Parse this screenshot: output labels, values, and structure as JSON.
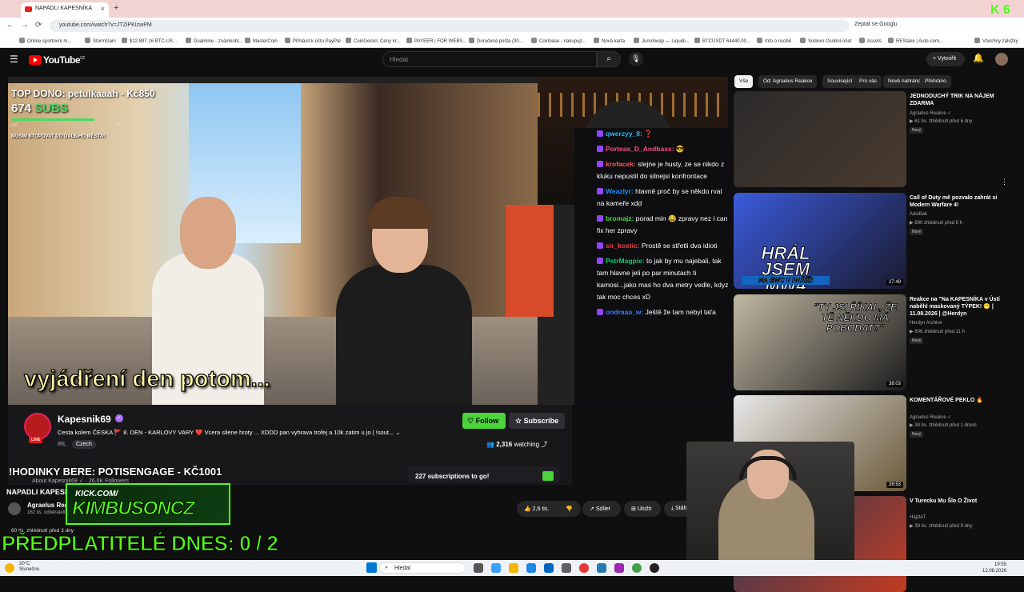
{
  "browser": {
    "tab_title": "NAPADLI KAPESNÍKA",
    "url": "youtube.com/watch?v=JTZiPKIzwPM",
    "ask_google": "Zeptat se Googlu",
    "all_bookmarks": "Všechny záložky",
    "bookmarks": [
      "Online sportovní m...",
      "StormGain",
      "$12,887.16 BTC-US...",
      "Dualmine - známkobt...",
      "MasterCoin",
      "Přihlásit k účtu PayPal",
      "CoinGecko: Ceny kr...",
      "PAYEER | FOR WEBS...",
      "Doručená pošta (30...",
      "Coinbase - nakupujt...",
      "Nová karta",
      "JunoSwap — Liquidi...",
      "BTCUSDT 64440.00...",
      "Info o osobě",
      "Sodexo Osobní účet",
      "Assets",
      "REStake | Auto-com..."
    ]
  },
  "youtube": {
    "logo": "YouTube",
    "logo_country": "CZ",
    "search_placeholder": "Hledat",
    "create_label": "Vytvořit"
  },
  "overlay": {
    "top_dono": "TOP DONO: petulkaaah - Kč850",
    "subs_count": "674",
    "subs_label": "SUBS",
    "sub_goal_min": "600",
    "sub_goal_max": "700",
    "sub_goal_progress": 0.74,
    "musim": "MUSÍM STOPOVAT DO DALŠÍHO MĚSTA!",
    "caption_main": "vyjádření ",
    "caption_rest": "den potom...",
    "kick_url": "KICK.COM/",
    "kick_name": "KIMBUSONCZ",
    "predplatitele": "PŘEDPLATITELÉ DNES: 0 / 2",
    "k6": "6"
  },
  "chat": [
    {
      "user": "qwerzyy_8:",
      "text": " ❓",
      "color": "#1fb9ff"
    },
    {
      "user": "Porteas_D_Andbass:",
      "text": " 😎",
      "color": "#ff4c8a"
    },
    {
      "user": "krofacek:",
      "text": " stejne je husty, ze se nikdo z kluku nepustil do silnejsi konfrontace",
      "color": "#ff5a5a"
    },
    {
      "user": "Weazlyr:",
      "text": " hlavně proč by se někdo rval na kameře xdd",
      "color": "#1e90ff"
    },
    {
      "user": "bromajz:",
      "text": " porad min 😂 zpravy nez i can fix her zpravy",
      "color": "#4ad43a"
    },
    {
      "user": "sir_kostic:",
      "text": " Prostě se střetli dva idioti",
      "color": "#ff3b3b"
    },
    {
      "user": "PetrMagpie:",
      "text": " to jak by mu najebali, tak tam hlavne jeli po par minutach ti kamosi...jako mas ho dva metry vedle, kdyz tak moc chces xD",
      "color": "#00d26a"
    },
    {
      "user": "ondraaa_w:",
      "text": " Ještě že tam nebyl taťa",
      "color": "#3d7bff"
    }
  ],
  "channel": {
    "name": "Kapesnik69",
    "live": "LIVE",
    "title": "Cesta kolem ČESKA 🚩 8. DEN - KARLOVY VARY ❤️ Vcera silene hroty ... XDDD pan vyhrava trofej a 10k zatim u jo | !sout... ⌄",
    "category": "IRL",
    "tag": "Czech",
    "follow": "Follow",
    "subscribe": "Subscribe",
    "watching_count": "2,316",
    "watching_label": "watching",
    "hodinky": "!HODINKY BERE: POTISENGAGE - KČ1001",
    "about": "About Kapesnik69 ✓ · 26.6K Followers",
    "subs_goal_text": "227 subscriptions to go!"
  },
  "video_page": {
    "title": "NAPADLI KAPESNÍKA",
    "channel": "Agraelus Reakce",
    "channel_subs": "162 tis. odběratelů",
    "likes": "2,6 tis.",
    "share": "Sdílet",
    "save": "Uložit",
    "download": "Stáhnout",
    "desc_stats": "60 tis. zhlédnutí  před 3 dny"
  },
  "chips": [
    "Vše",
    "Od: Agraelus Reakce",
    "Související",
    "Pro vás",
    "Nově nahráno",
    "Přehráno"
  ],
  "related": [
    {
      "title": "JEDNODUCHÝ TRIK NA NÁJEM ZDARMA",
      "channel": "Agraelus Reakce ✓",
      "meta": "61 tis. zhlédnutí  před 6 dny",
      "badge": "Nový",
      "duration": ""
    },
    {
      "title": "Call of Duty mě pozvalo zahrát si Modern Warfare 4!",
      "channel": "AdisBak",
      "meta": "890 zhlédnutí  před 5 h",
      "badge": "Nový",
      "duration": "27:49",
      "thumb_text": "HRÁL JSEM MW4",
      "thumb_sub": "NA EWC V PAŘÍŽI"
    },
    {
      "title": "Reakce na \"Na KAPESNÍKA v Ústí naběhl maskovaný TÝPEK! 😬 | 11.08.2026 | @Herdyn",
      "channel": "Herdyn Archive",
      "meta": "606 zhlédnutí  před 11 h",
      "badge": "Nový",
      "duration": "38:03",
      "thumb_text": "\"TY JSI ŘÍKAL, ŽE TĚ NĚKDO MÁ POBODAT?\""
    },
    {
      "title": "KOMENTÁŘOVÉ PEKLO 🔥",
      "channel": "Agraelus Reakce ✓",
      "meta": "38 tis. zhlédnutí  před 1 dnem",
      "badge": "Nový",
      "duration": "26:53"
    },
    {
      "title": "V Turecku Mu Šlo O Život",
      "channel": "HajzleT",
      "meta": "39 tis. zhlédnutí  před 9 dny",
      "badge": "",
      "duration": ""
    }
  ],
  "taskbar": {
    "temp": "20°C",
    "weather": "Slunečno",
    "search": "Hledat",
    "time": "19:55",
    "date": "12.08.2026"
  }
}
